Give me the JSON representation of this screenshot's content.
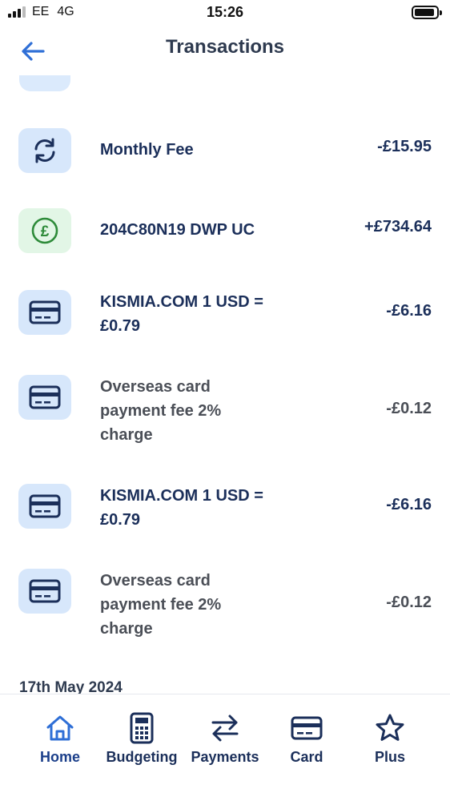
{
  "status_bar": {
    "carrier": "EE",
    "network": "4G",
    "time": "15:26"
  },
  "header": {
    "title": "Transactions"
  },
  "transactions": [
    {
      "icon": "refresh-icon",
      "description": "Monthly Fee",
      "amount": "-£15.95"
    },
    {
      "icon": "pound-icon",
      "description": "204C80N19 DWP UC",
      "amount": "+£734.64"
    },
    {
      "icon": "card-icon",
      "description": "KISMIA.COM 1 USD = £0.79",
      "amount": "-£6.16"
    },
    {
      "icon": "card-icon",
      "description": "Overseas card payment fee 2% charge",
      "amount": "-£0.12"
    },
    {
      "icon": "card-icon",
      "description": "KISMIA.COM 1 USD = £0.79",
      "amount": "-£6.16"
    },
    {
      "icon": "card-icon",
      "description": "Overseas card payment fee 2% charge",
      "amount": "-£0.12"
    }
  ],
  "date_header": "17th May 2024",
  "tab_bar": {
    "active": "Home",
    "tabs": [
      {
        "label": "Home",
        "icon": "home-icon"
      },
      {
        "label": "Budgeting",
        "icon": "calculator-icon"
      },
      {
        "label": "Payments",
        "icon": "transfer-arrows-icon"
      },
      {
        "label": "Card",
        "icon": "card-icon"
      },
      {
        "label": "Plus",
        "icon": "star-icon"
      }
    ]
  },
  "colors": {
    "accent": "#2f6fd6",
    "text_dark": "#1b2f5a",
    "icon_bg": "#d7e7fb",
    "icon_bg_green": "#e2f6e6",
    "green": "#2e8b3a"
  }
}
